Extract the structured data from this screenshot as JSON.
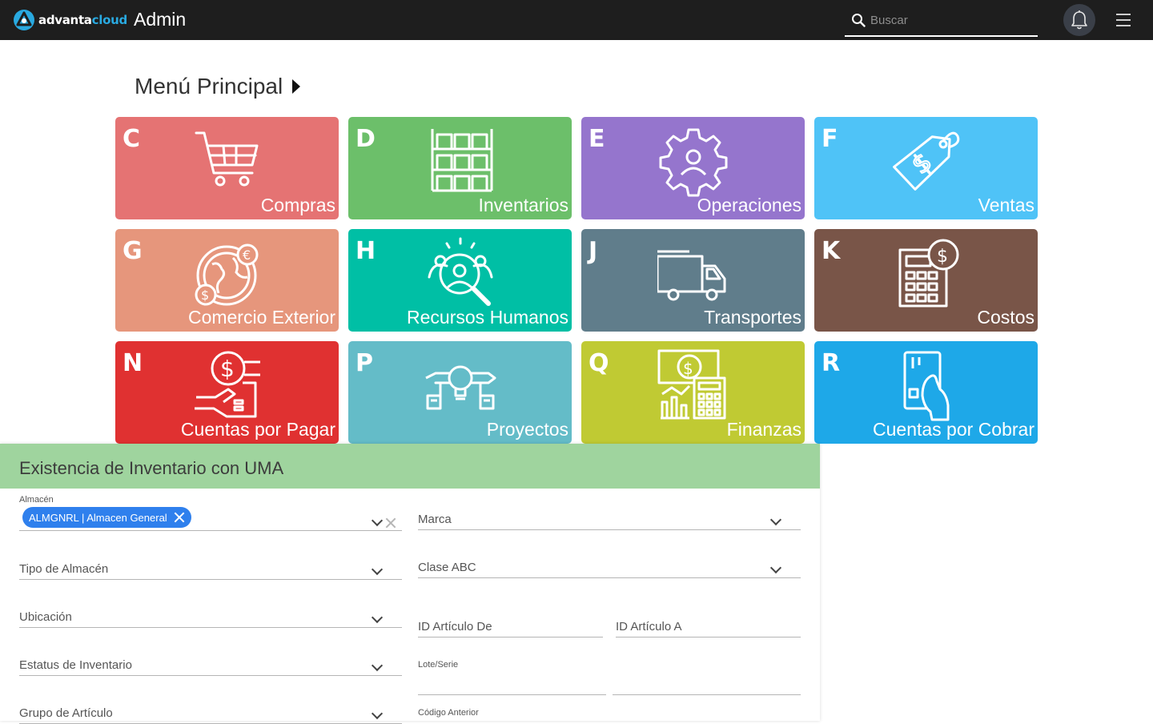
{
  "topbar": {
    "logo_part1": "advanta",
    "logo_part2": "cloud",
    "title": "Admin",
    "search_placeholder": "Buscar",
    "icons": [
      "search-icon",
      "bell-icon",
      "hamburger-menu-icon"
    ]
  },
  "main_menu": {
    "heading": "Menú Principal",
    "tiles": [
      {
        "letter": "C",
        "label": "Compras",
        "color": "#e57373",
        "icon": "shopping-cart-icon"
      },
      {
        "letter": "D",
        "label": "Inventarios",
        "color": "#6cbf6a",
        "icon": "warehouse-shelves-icon"
      },
      {
        "letter": "E",
        "label": "Operaciones",
        "color": "#9575cd",
        "icon": "gear-person-icon"
      },
      {
        "letter": "F",
        "label": "Ventas",
        "color": "#4fc3f7",
        "icon": "price-tag-icon"
      },
      {
        "letter": "G",
        "label": "Comercio Exterior",
        "color": "#e6967c",
        "icon": "globe-currency-icon"
      },
      {
        "letter": "H",
        "label": "Recursos Humanos",
        "color": "#00bfa5",
        "icon": "person-search-icon"
      },
      {
        "letter": "J",
        "label": "Transportes",
        "color": "#607d8b",
        "icon": "truck-icon"
      },
      {
        "letter": "K",
        "label": "Costos",
        "color": "#795548",
        "icon": "calculator-dollar-icon"
      },
      {
        "letter": "N",
        "label": "Cuentas por Pagar",
        "color": "#e03131",
        "icon": "hand-dollar-icon"
      },
      {
        "letter": "P",
        "label": "Proyectos",
        "color": "#64bcc8",
        "icon": "lightbulb-plan-icon"
      },
      {
        "letter": "Q",
        "label": "Finanzas",
        "color": "#c0ca33",
        "icon": "finance-calculator-icon"
      },
      {
        "letter": "R",
        "label": "Cuentas por Cobrar",
        "color": "#1ea8e8",
        "icon": "card-hand-icon"
      }
    ]
  },
  "panel": {
    "title": "Existencia de Inventario con UMA",
    "almacen_label": "Almacén",
    "almacen_chip": "ALMGNRL | Almacen General",
    "marca_label": "Marca",
    "tipo_almacen_label": "Tipo de Almacén",
    "clase_abc_label": "Clase ABC",
    "ubicacion_label": "Ubicación",
    "id_articulo_de_label": "ID Artículo De",
    "id_articulo_a_label": "ID Artículo A",
    "estatus_label": "Estatus de Inventario",
    "lote_serie_label": "Lote/Serie",
    "grupo_articulo_label": "Grupo de Artículo",
    "codigo_anterior_label": "Código Anterior"
  }
}
